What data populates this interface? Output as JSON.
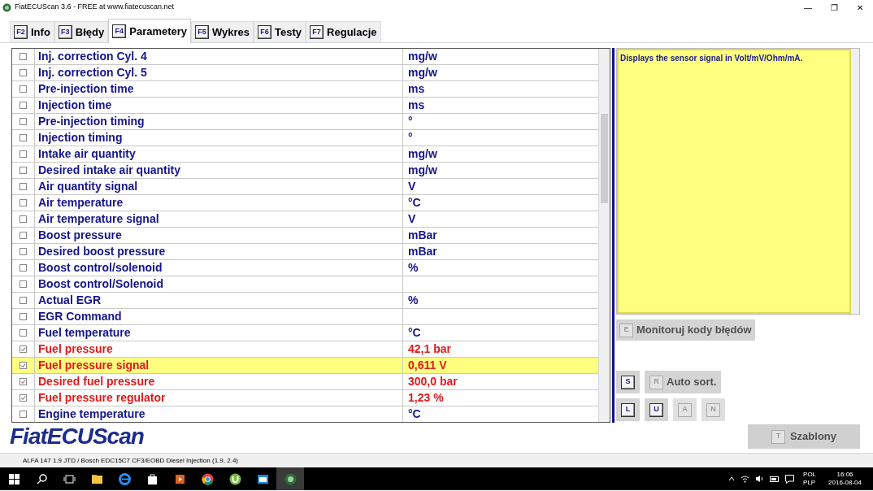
{
  "window": {
    "title": "FiatECUScan 3.6 - FREE at www.fiatecuscan.net",
    "controls": [
      "—",
      "❐",
      "✕"
    ]
  },
  "tabs": [
    {
      "key": "F2",
      "label": "Info",
      "selected": false
    },
    {
      "key": "F3",
      "label": "Błędy",
      "selected": false
    },
    {
      "key": "F4",
      "label": "Parametery",
      "selected": true
    },
    {
      "key": "F5",
      "label": "Wykres",
      "selected": false
    },
    {
      "key": "F6",
      "label": "Testy",
      "selected": false
    },
    {
      "key": "F7",
      "label": "Regulacje",
      "selected": false
    }
  ],
  "parameters": [
    {
      "name": "Inj. correction Cyl. 4",
      "value": "mg/w",
      "checked": false,
      "selected": false
    },
    {
      "name": "Inj. correction Cyl. 5",
      "value": "mg/w",
      "checked": false,
      "selected": false
    },
    {
      "name": "Pre-injection time",
      "value": "ms",
      "checked": false,
      "selected": false
    },
    {
      "name": "Injection time",
      "value": "ms",
      "checked": false,
      "selected": false
    },
    {
      "name": "Pre-injection timing",
      "value": "°",
      "checked": false,
      "selected": false
    },
    {
      "name": "Injection timing",
      "value": "°",
      "checked": false,
      "selected": false
    },
    {
      "name": "Intake air quantity",
      "value": "mg/w",
      "checked": false,
      "selected": false
    },
    {
      "name": "Desired intake air quantity",
      "value": "mg/w",
      "checked": false,
      "selected": false
    },
    {
      "name": "Air quantity signal",
      "value": "V",
      "checked": false,
      "selected": false
    },
    {
      "name": "Air temperature",
      "value": "°C",
      "checked": false,
      "selected": false
    },
    {
      "name": "Air temperature signal",
      "value": "V",
      "checked": false,
      "selected": false
    },
    {
      "name": "Boost pressure",
      "value": "mBar",
      "checked": false,
      "selected": false
    },
    {
      "name": "Desired boost pressure",
      "value": "mBar",
      "checked": false,
      "selected": false
    },
    {
      "name": "Boost control/solenoid",
      "value": "%",
      "checked": false,
      "selected": false
    },
    {
      "name": "Boost control/Solenoid",
      "checked": false,
      "selected": false
    },
    {
      "name": "Actual EGR",
      "value": "%",
      "checked": false,
      "selected": false
    },
    {
      "name": "EGR Command",
      "checked": false,
      "selected": false
    },
    {
      "name": "Fuel temperature",
      "value": "°C",
      "checked": false,
      "selected": false
    },
    {
      "name": "Fuel pressure",
      "value": "42,1 bar",
      "checked": true,
      "selected": false
    },
    {
      "name": "Fuel pressure signal",
      "value": "0,611 V",
      "checked": true,
      "selected": true
    },
    {
      "name": "Desired fuel pressure",
      "value": "300,0 bar",
      "checked": true,
      "selected": false
    },
    {
      "name": "Fuel pressure regulator",
      "value": "1,23 %",
      "checked": true,
      "selected": false
    },
    {
      "name": "Engine temperature",
      "value": "°C",
      "checked": false,
      "selected": false
    }
  ],
  "description": "Displays the sensor signal in Volt/mV/Ohm/mA.",
  "monitor_button": {
    "key": "E",
    "label": "Monitoruj kody błędów"
  },
  "sort_buttons": [
    {
      "key": "S",
      "disabled": false
    },
    {
      "key": "R",
      "label": "Auto sort.",
      "disabled": false
    }
  ],
  "filter_buttons": [
    {
      "key": "L",
      "disabled": false
    },
    {
      "key": "U",
      "disabled": false
    },
    {
      "key": "A",
      "disabled": true
    },
    {
      "key": "N",
      "disabled": true
    }
  ],
  "logo": "FiatECUScan",
  "templates_button": {
    "key": "T",
    "label": "Szablony"
  },
  "status_bar": "ALFA 147 1.9 JTD / Bosch EDC15C7 CF3/EOBD Diesel Injection (1.9, 2.4)",
  "taskbar": {
    "language": "POL",
    "layout": "PLP",
    "time": "16:06",
    "date": "2016-08-04"
  }
}
